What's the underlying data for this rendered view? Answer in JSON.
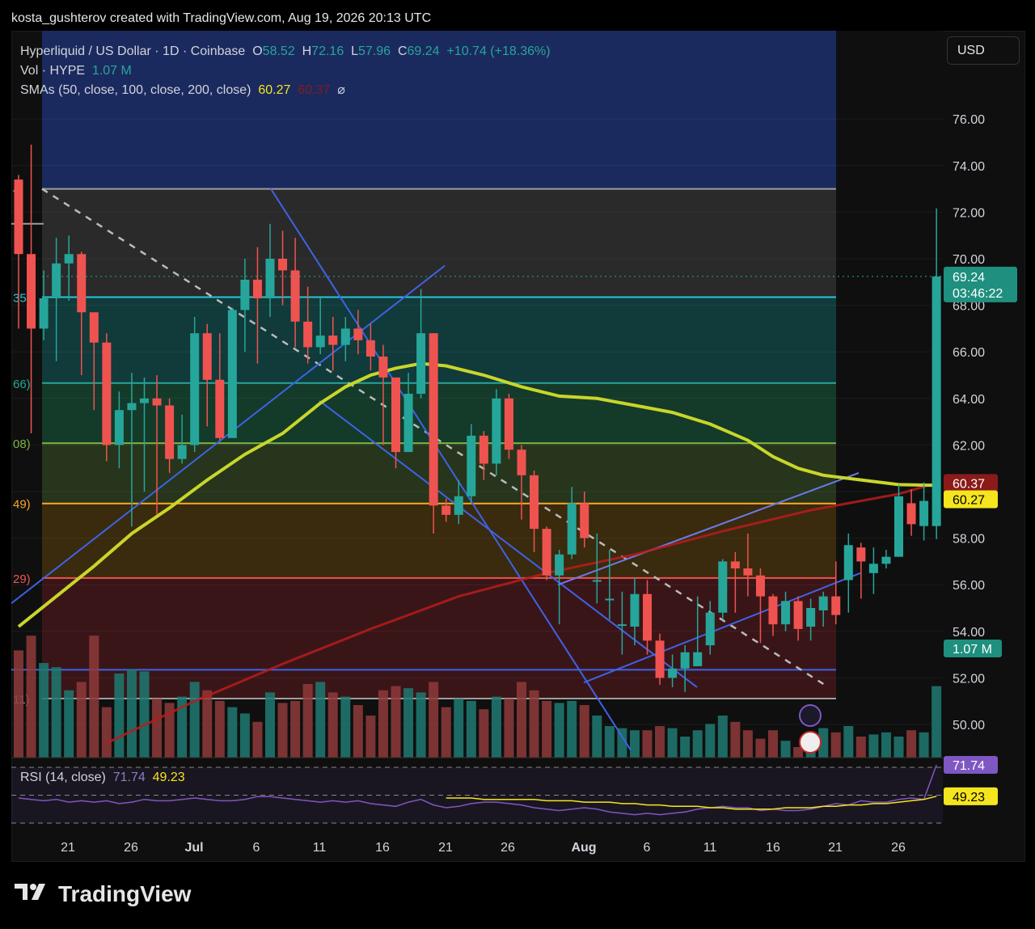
{
  "header": {
    "text": "kosta_gushterov created with TradingView.com, Aug 19, 2026 20:13 UTC"
  },
  "legend": {
    "symbol": "Hyperliquid / US Dollar · 1D · Coinbase",
    "o_label": "O",
    "o": "58.52",
    "h_label": "H",
    "h": "72.16",
    "l_label": "L",
    "l": "57.96",
    "c_label": "C",
    "c": "69.24",
    "change": "+10.74 (+18.36%)",
    "vol_label": "Vol · HYPE",
    "vol": "1.07 M",
    "sma_label": "SMAs (50, close, 100, close, 200, close)",
    "sma50": "60.27",
    "sma100": "60.37",
    "sma_icon": "⌀"
  },
  "currency_button": "USD",
  "rsi": {
    "label": "RSI (14, close)",
    "value": "71.74",
    "ma": "49.23"
  },
  "footer": {
    "brand": "TradingView",
    "logo_icon": "tradingview-logo-icon"
  },
  "colors": {
    "up": "#26a69a",
    "down": "#ef5350",
    "sma50": "#c8d62a",
    "sma100": "#b71c1c",
    "channel": "#3d63e6",
    "rsi": "#7e57c2"
  },
  "chart_data": {
    "type": "candlestick",
    "y_ticks": [
      "76.00",
      "74.00",
      "72.00",
      "70.00",
      "68.00",
      "66.00",
      "64.00",
      "62.00",
      "60.00",
      "58.00",
      "56.00",
      "54.00",
      "52.00",
      "50.00"
    ],
    "x_ticks": [
      "21",
      "26",
      "Jul",
      "6",
      "11",
      "16",
      "21",
      "26",
      "Aug",
      "6",
      "11",
      "16",
      "21",
      "26"
    ],
    "fib_labels": [
      "4",
      "35",
      "66)",
      "08)",
      "49)",
      "29)",
      "11)"
    ],
    "fib_levels": [
      73.0,
      68.35,
      64.66,
      62.08,
      59.49,
      56.29,
      51.11
    ],
    "price_tags": {
      "last": "69.24",
      "countdown": "03:46:22",
      "volume": "1.07 M",
      "sma100": "60.37",
      "sma50": "60.27"
    },
    "candles": [
      [
        70.2,
        73.6,
        67.0,
        73.4
      ],
      [
        67.0,
        74.9,
        62.5,
        70.2
      ],
      [
        68.3,
        69.5,
        66.5,
        67.0
      ],
      [
        69.8,
        70.9,
        65.6,
        68.3
      ],
      [
        70.2,
        71.0,
        68.2,
        69.8
      ],
      [
        67.7,
        70.3,
        65.0,
        70.2
      ],
      [
        66.4,
        67.2,
        63.5,
        67.7
      ],
      [
        62.0,
        66.8,
        61.3,
        66.4
      ],
      [
        63.5,
        64.3,
        61.0,
        62.0
      ],
      [
        63.8,
        65.1,
        58.5,
        63.5
      ],
      [
        64.0,
        64.9,
        60.0,
        63.8
      ],
      [
        63.7,
        65.0,
        59.0,
        64.0
      ],
      [
        61.4,
        64.0,
        60.8,
        63.7
      ],
      [
        62.0,
        63.3,
        61.2,
        61.4
      ],
      [
        66.8,
        67.5,
        61.7,
        62.0
      ],
      [
        64.8,
        67.2,
        62.8,
        66.8
      ],
      [
        62.3,
        66.8,
        62.2,
        64.8
      ],
      [
        67.8,
        67.9,
        63.0,
        62.3
      ],
      [
        69.1,
        70.0,
        66.0,
        67.8
      ],
      [
        68.3,
        70.5,
        65.5,
        69.1
      ],
      [
        70.0,
        71.5,
        67.5,
        68.3
      ],
      [
        69.5,
        71.2,
        68.0,
        70.0
      ],
      [
        67.3,
        70.9,
        66.2,
        69.5
      ],
      [
        66.2,
        68.8,
        65.5,
        67.3
      ],
      [
        66.7,
        68.4,
        65.9,
        66.2
      ],
      [
        66.3,
        67.5,
        65.2,
        66.7
      ],
      [
        67.0,
        67.5,
        65.6,
        66.3
      ],
      [
        66.5,
        67.8,
        65.9,
        67.0
      ],
      [
        65.8,
        67.2,
        65.2,
        66.5
      ],
      [
        64.9,
        66.3,
        62.0,
        65.8
      ],
      [
        61.7,
        64.9,
        61.0,
        64.9
      ],
      [
        64.2,
        65.1,
        61.7,
        61.7
      ],
      [
        66.8,
        68.7,
        64.0,
        64.2
      ],
      [
        59.4,
        66.8,
        58.2,
        66.8
      ],
      [
        59.0,
        59.7,
        58.7,
        59.4
      ],
      [
        59.8,
        60.5,
        58.6,
        59.0
      ],
      [
        62.4,
        62.9,
        59.5,
        59.8
      ],
      [
        61.2,
        62.6,
        60.5,
        62.4
      ],
      [
        64.0,
        64.4,
        60.7,
        61.2
      ],
      [
        61.8,
        64.2,
        61.4,
        64.0
      ],
      [
        60.7,
        62.0,
        58.8,
        61.8
      ],
      [
        58.4,
        60.9,
        57.4,
        60.7
      ],
      [
        56.4,
        58.5,
        56.2,
        58.4
      ],
      [
        57.3,
        57.5,
        54.3,
        56.4
      ],
      [
        59.5,
        60.2,
        57.1,
        57.3
      ],
      [
        58.0,
        60.0,
        57.6,
        59.5
      ],
      [
        56.2,
        58.2,
        55.2,
        56.2
      ],
      [
        55.4,
        57.5,
        54.5,
        55.4
      ],
      [
        54.3,
        55.7,
        53.0,
        54.3
      ],
      [
        55.6,
        56.3,
        53.4,
        54.2
      ],
      [
        53.6,
        56.2,
        53.0,
        55.6
      ],
      [
        52.0,
        53.9,
        51.7,
        53.6
      ],
      [
        52.4,
        53.0,
        51.6,
        52.0
      ],
      [
        53.1,
        53.4,
        51.4,
        52.4
      ],
      [
        53.1,
        55.5,
        52.8,
        52.5
      ],
      [
        54.8,
        55.3,
        53.0,
        53.4
      ],
      [
        57.0,
        57.1,
        54.5,
        54.8
      ],
      [
        56.7,
        57.4,
        54.8,
        57.0
      ],
      [
        56.4,
        58.2,
        55.5,
        56.7
      ],
      [
        55.5,
        56.7,
        53.5,
        56.4
      ],
      [
        54.3,
        55.6,
        53.8,
        55.5
      ],
      [
        55.3,
        55.7,
        54.0,
        54.3
      ],
      [
        54.1,
        55.5,
        53.6,
        55.3
      ],
      [
        55.0,
        55.4,
        53.6,
        54.2
      ],
      [
        55.5,
        55.7,
        54.2,
        54.9
      ],
      [
        54.7,
        57.0,
        54.3,
        55.5
      ],
      [
        57.7,
        58.2,
        54.8,
        56.2
      ],
      [
        57.0,
        57.8,
        55.4,
        57.6
      ],
      [
        56.9,
        57.6,
        55.6,
        56.5
      ],
      [
        57.2,
        57.5,
        56.7,
        56.9
      ],
      [
        59.8,
        60.3,
        57.2,
        57.2
      ],
      [
        58.6,
        60.1,
        58.1,
        59.5
      ],
      [
        59.6,
        60.4,
        57.9,
        58.52
      ],
      [
        69.24,
        72.16,
        57.96,
        58.52
      ]
    ],
    "volumes": [
      0.51,
      0.58,
      0.45,
      0.43,
      0.32,
      0.36,
      0.58,
      0.24,
      0.4,
      0.42,
      0.41,
      0.28,
      0.26,
      0.29,
      0.36,
      0.32,
      0.27,
      0.24,
      0.21,
      0.17,
      0.31,
      0.26,
      0.27,
      0.35,
      0.36,
      0.31,
      0.29,
      0.25,
      0.2,
      0.32,
      0.34,
      0.33,
      0.31,
      0.36,
      0.24,
      0.28,
      0.27,
      0.23,
      0.29,
      0.28,
      0.36,
      0.32,
      0.27,
      0.26,
      0.27,
      0.25,
      0.2,
      0.15,
      0.14,
      0.13,
      0.13,
      0.15,
      0.14,
      0.1,
      0.13,
      0.16,
      0.2,
      0.17,
      0.13,
      0.09,
      0.13,
      0.08,
      0.05,
      0.09,
      0.14,
      0.12,
      0.15,
      0.1,
      0.11,
      0.12,
      0.1,
      0.13,
      0.12,
      0.34
    ],
    "sma50": [
      [
        0,
        54.2
      ],
      [
        3,
        55.5
      ],
      [
        6,
        56.8
      ],
      [
        9,
        58.2
      ],
      [
        12,
        59.3
      ],
      [
        15,
        60.5
      ],
      [
        18,
        61.6
      ],
      [
        21,
        62.5
      ],
      [
        24,
        63.8
      ],
      [
        26,
        64.5
      ],
      [
        28,
        65.0
      ],
      [
        30,
        65.3
      ],
      [
        32,
        65.5
      ],
      [
        34,
        65.4
      ],
      [
        37,
        65.0
      ],
      [
        40,
        64.5
      ],
      [
        43,
        64.1
      ],
      [
        46,
        64.0
      ],
      [
        49,
        63.7
      ],
      [
        52,
        63.4
      ],
      [
        55,
        62.9
      ],
      [
        58,
        62.2
      ],
      [
        60,
        61.5
      ],
      [
        62,
        61.0
      ],
      [
        64,
        60.7
      ],
      [
        67,
        60.5
      ],
      [
        70,
        60.3
      ],
      [
        73,
        60.27
      ]
    ],
    "sma100": [
      [
        7,
        49.2
      ],
      [
        14,
        51.0
      ],
      [
        21,
        52.6
      ],
      [
        28,
        54.1
      ],
      [
        35,
        55.5
      ],
      [
        42,
        56.5
      ],
      [
        49,
        57.3
      ],
      [
        56,
        58.3
      ],
      [
        63,
        59.2
      ],
      [
        70,
        59.9
      ],
      [
        73,
        60.37
      ]
    ],
    "rsi_values": [
      48,
      47,
      46,
      47,
      45,
      46,
      45,
      46,
      44,
      45,
      47,
      46,
      46,
      47,
      48,
      47,
      46,
      46,
      47,
      49,
      49,
      48,
      47,
      46,
      45,
      46,
      45,
      46,
      44,
      43,
      42,
      45,
      47,
      43,
      41,
      42,
      44,
      45,
      45,
      44,
      43,
      41,
      40,
      39,
      40,
      41,
      40,
      38,
      37,
      36,
      37,
      36,
      37,
      38,
      40,
      41,
      42,
      41,
      41,
      39,
      40,
      39,
      39,
      40,
      42,
      44,
      43,
      46,
      45,
      45,
      47,
      48,
      47,
      71.74
    ],
    "rsi_ma": [
      48,
      48,
      48,
      47,
      47,
      47,
      47,
      47,
      46,
      46,
      46,
      45,
      45,
      45,
      44,
      44,
      43,
      43,
      42,
      42,
      42,
      41,
      41,
      40,
      40,
      40,
      40,
      41,
      41,
      41,
      42,
      42,
      43,
      43,
      44,
      44,
      45,
      46,
      47,
      49.23
    ]
  }
}
